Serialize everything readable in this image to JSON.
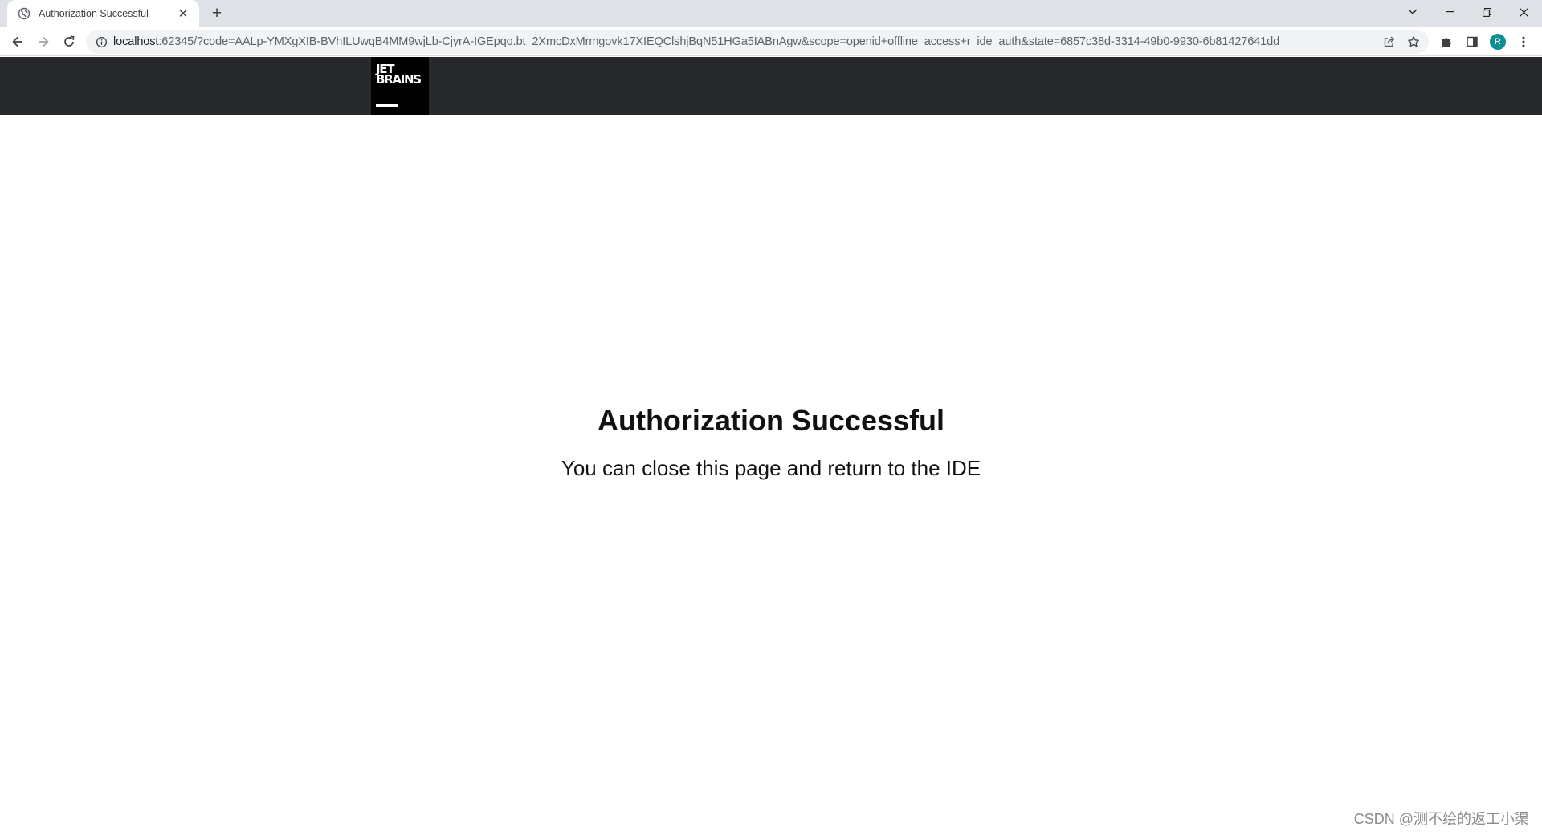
{
  "browser": {
    "tab": {
      "title": "Authorization Successful",
      "close": "✕"
    },
    "new_tab": "+",
    "window_controls": {
      "tab_search": "⌄",
      "minimize": "─",
      "restore": "❐",
      "close": "✕"
    },
    "address": {
      "host": "localhost",
      "rest": ":62345/?code=AALp-YMXgXIB-BVhILUwqB4MM9wjLb-CjyrA-IGEpqo.bt_2XmcDxMrmgovk17XIEQClshjBqN51HGa5IABnAgw&scope=openid+offline_access+r_ide_auth&state=6857c38d-3314-49b0-9930-6b81427641dd"
    },
    "profile_initial": "R",
    "icons": {
      "back": "back-arrow-icon",
      "forward": "forward-arrow-icon",
      "reload": "reload-icon",
      "site_info": "info-icon",
      "share": "share-icon",
      "bookmark": "star-icon",
      "extensions": "puzzle-icon",
      "side_panel": "side-panel-icon",
      "menu": "kebab-menu-icon"
    }
  },
  "page": {
    "logo_text": "JET\nBRAINS",
    "heading": "Authorization Successful",
    "message": "You can close this page and return to the IDE"
  },
  "watermark": "CSDN @测不绘的返工小渠",
  "colors": {
    "header_bar": "#27282c",
    "logo_bg": "#000000",
    "avatar": "#0f8f94"
  }
}
